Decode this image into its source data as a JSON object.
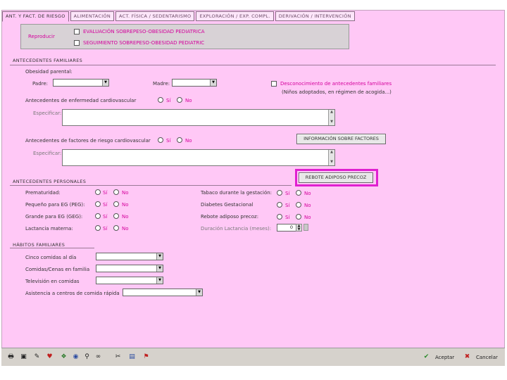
{
  "tabs": [
    {
      "label": "ANT. Y FACT. DE RIESGO",
      "active": true
    },
    {
      "label": "ALIMENTACIÓN",
      "active": false
    },
    {
      "label": "ACT. FÍSICA / SEDENTARISMO",
      "active": false
    },
    {
      "label": "EXPLORACIÓN / EXP. COMPL.",
      "active": false
    },
    {
      "label": "DERIVACIÓN / INTERVENCIÓN",
      "active": false
    }
  ],
  "top_panel": {
    "label": "Reproducir",
    "options": [
      "EVALUACIÓN SOBREPESO-OBESIDAD PEDIATRICA",
      "SEGUIMIENTO SOBREPESO-OBESIDAD PEDIATRIC"
    ]
  },
  "familiares": {
    "title": "ANTECEDENTES FAMILIARES",
    "obesidad_label": "Obesidad parental:",
    "padre_label": "Padre:",
    "madre_label": "Madre:",
    "desconocimiento_label": "Desconocimiento de antecedentes familiares",
    "desconocimiento_note": "(Niños adoptados, en régimen de acogida...)",
    "cardio_label": "Antecedentes de enfermedad cardiovascular",
    "cardio_specify": "Especificar:",
    "riesgo_label": "Antecedentes de factores de riesgo cardiovascular",
    "riesgo_specify": "Especificar:",
    "info_button": "INFORMACIÓN SOBRE FACTORES",
    "si": "Sí",
    "no": "No"
  },
  "personales": {
    "title": "ANTECEDENTES PERSONALES",
    "rebote_button": "REBOTE ADIPOSO PRECOZ",
    "left": [
      {
        "label": "Prematuridad:",
        "si": "Sí",
        "no": "No"
      },
      {
        "label": "Pequeño para EG (PEG):",
        "si": "Sí",
        "no": "No"
      },
      {
        "label": "Grande para EG (GEG):",
        "si": "Sí",
        "no": "No"
      },
      {
        "label": "Lactancia materna:",
        "si": "Sí",
        "no": "No"
      }
    ],
    "right": [
      {
        "label": "Tabaco durante la gestación:",
        "si": "Sí",
        "no": "No"
      },
      {
        "label": "Diabetes Gestacional",
        "si": "Sí",
        "no": "No"
      },
      {
        "label": "Rebote adiposo precoz:",
        "si": "Sí",
        "no": "No"
      }
    ],
    "duracion_label": "Duración Lactancia (meses):",
    "duracion_value": "0"
  },
  "habitos": {
    "title": "HÁBITOS FAMILIARES",
    "items": [
      "Cinco comidas al día",
      "Comidas/Cenas en familia",
      "Televisión en comidas",
      "Asistencia a centros de comida rápida"
    ]
  },
  "toolbar": {
    "accept": "Aceptar",
    "cancel": "Cancelar"
  }
}
